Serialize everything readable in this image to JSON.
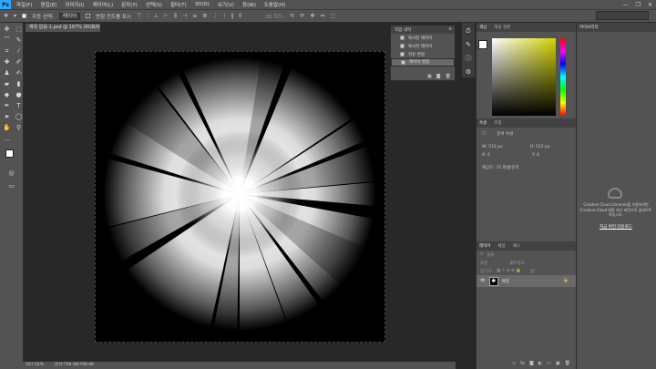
{
  "menubar": {
    "logo": "Ps",
    "items": [
      "파일(F)",
      "편집(E)",
      "이미지(I)",
      "레이어(L)",
      "문자(Y)",
      "선택(S)",
      "필터(T)",
      "3D(D)",
      "보기(V)",
      "창(W)",
      "도움말(H)"
    ],
    "window_controls": [
      "—",
      "❐",
      "✕"
    ]
  },
  "options": {
    "auto_select_label": "자동 선택:",
    "auto_select_value": "레이어",
    "transform_label": "변형 컨트롤 표시",
    "mode_label": "3D 모드:"
  },
  "document": {
    "tab_title": "제목 없음-1.psd @ 167% (RGB/8#) *",
    "status_zoom": "167.02%",
    "status_doc": "문서:768.0K/768.0K"
  },
  "history": {
    "tabs": [
      "작업 내역"
    ],
    "items": [
      "복사한 레이어",
      "복사한 레이어",
      "자유 변형",
      "레이어 병합"
    ],
    "selected_index": 3
  },
  "color_panel": {
    "tabs": [
      "색상",
      "색상 견본"
    ],
    "fg": "#ffffff",
    "bg": "#000000"
  },
  "props_panel": {
    "tabs": [
      "속성",
      "조정"
    ],
    "kind": "문서 속성",
    "w_label": "W:",
    "w_value": "512 px",
    "h_label": "H:",
    "h_value": "512 px",
    "x_label": "X:",
    "x_value": "4",
    "y_label": "Y:",
    "y_value": "8",
    "resolution": "해상도: 72 픽셀/인치"
  },
  "layers_panel": {
    "tabs": [
      "레이어",
      "채널",
      "패스"
    ],
    "kind_label": "종류",
    "mode_value": "표준",
    "opacity_label": "불투명도:",
    "lock_label": "잠그기:",
    "fill_label": "칠:",
    "layer_name": "배경"
  },
  "libraries": {
    "title": "라이브러리",
    "message": "Creative Cloud Libraries를 사용하려면 Creative Cloud 앱을 최신 버전으로 업데이트하십시오.",
    "link": "지금 버전 다운로드"
  }
}
